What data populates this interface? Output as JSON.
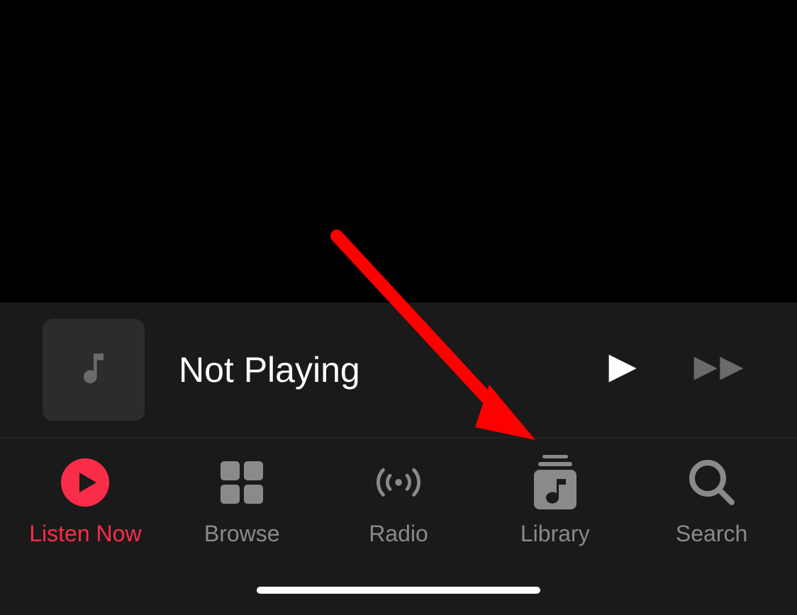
{
  "now_playing": {
    "status_text": "Not Playing"
  },
  "tabs": [
    {
      "label": "Listen Now",
      "active": true
    },
    {
      "label": "Browse",
      "active": false
    },
    {
      "label": "Radio",
      "active": false
    },
    {
      "label": "Library",
      "active": false
    },
    {
      "label": "Search",
      "active": false
    }
  ],
  "colors": {
    "accent": "#fa2d48",
    "inactive": "#8a8a8a",
    "background_dark": "#000000",
    "background_panel": "#1a1a1a"
  },
  "annotation": {
    "type": "arrow",
    "target": "library-tab",
    "color": "#ff0000"
  }
}
